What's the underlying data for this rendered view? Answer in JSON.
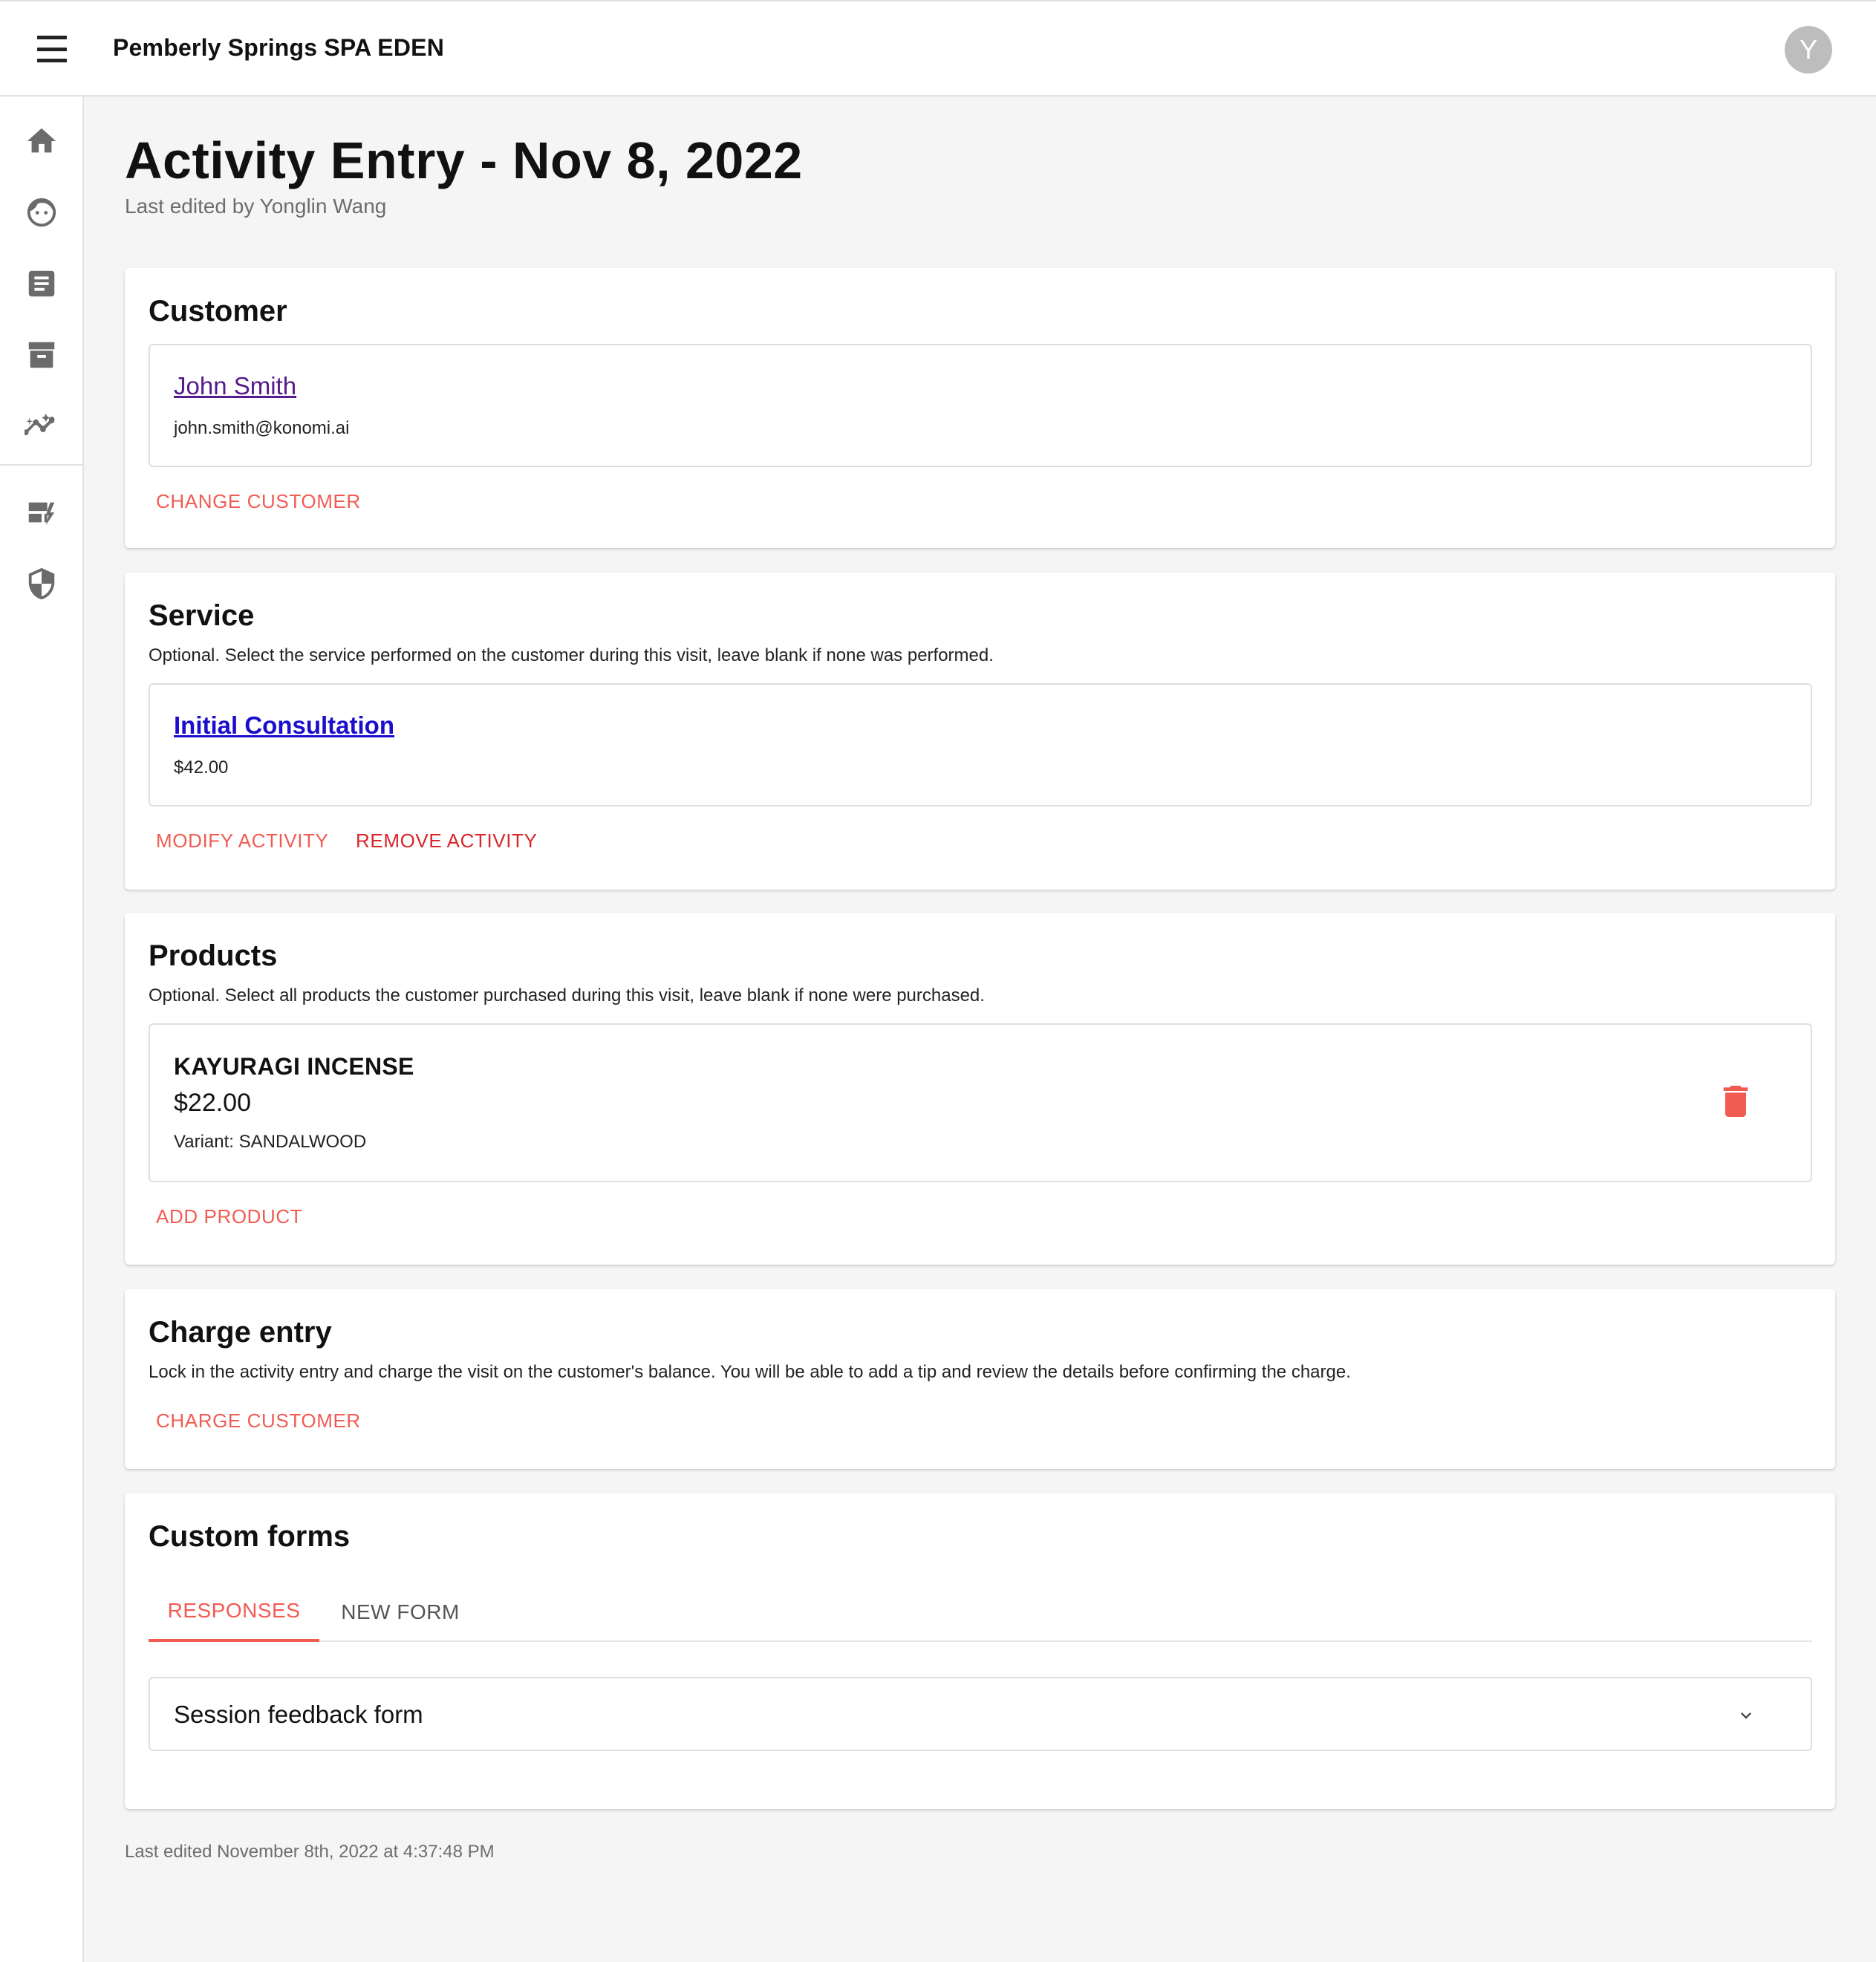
{
  "header": {
    "title": "Pemberly Springs SPA EDEN",
    "avatar_initial": "Y",
    "menu_icon": "menu-icon"
  },
  "sidebar": {
    "items": [
      {
        "icon": "home-icon"
      },
      {
        "icon": "face-icon"
      },
      {
        "icon": "document-icon"
      },
      {
        "icon": "archive-icon"
      },
      {
        "icon": "insights-icon"
      },
      {
        "icon": "dashboard-edit-icon"
      },
      {
        "icon": "shield-icon"
      }
    ]
  },
  "page": {
    "title": "Activity Entry - Nov 8, 2022",
    "subtitle": "Last edited by Yonglin Wang",
    "footer": "Last edited November 8th, 2022 at 4:37:48 PM"
  },
  "customer": {
    "heading": "Customer",
    "name": "John Smith",
    "email": "john.smith@konomi.ai",
    "change_label": "CHANGE CUSTOMER"
  },
  "service": {
    "heading": "Service",
    "description": "Optional. Select the service performed on the customer during this visit, leave blank if none was performed.",
    "name": "Initial Consultation",
    "price": "$42.00",
    "modify_label": "MODIFY ACTIVITY",
    "remove_label": "REMOVE ACTIVITY"
  },
  "products": {
    "heading": "Products",
    "description": "Optional. Select all products the customer purchased during this visit, leave blank if none were purchased.",
    "items": [
      {
        "name": "KAYURAGI INCENSE",
        "price": "$22.00",
        "variant": "Variant: SANDALWOOD"
      }
    ],
    "add_label": "ADD PRODUCT"
  },
  "charge": {
    "heading": "Charge entry",
    "description": "Lock in the activity entry and charge the visit on the customer's balance. You will be able to add a tip and review the details before confirming the charge.",
    "charge_label": "CHARGE CUSTOMER"
  },
  "custom_forms": {
    "heading": "Custom forms",
    "tabs": [
      {
        "label": "RESPONSES",
        "active": true
      },
      {
        "label": "NEW FORM",
        "active": false
      }
    ],
    "forms": [
      {
        "label": "Session feedback form"
      }
    ]
  },
  "colors": {
    "accent": "#f25b52",
    "danger": "#d8262a",
    "link_visited": "#551a8b",
    "link": "#1a0dcc"
  }
}
